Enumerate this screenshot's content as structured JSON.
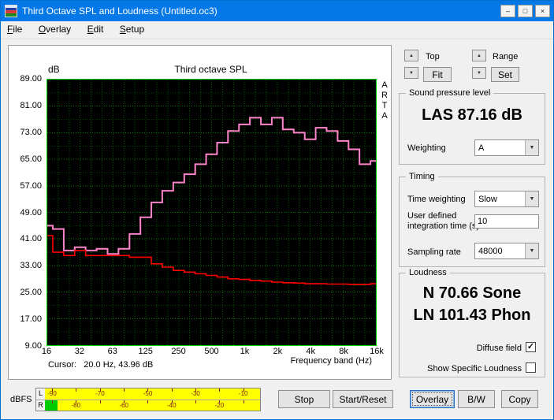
{
  "window": {
    "title": "Third Octave SPL and Loudness (Untitled.oc3)",
    "controls": {
      "minimize": "–",
      "maximize": "□",
      "close": "×"
    }
  },
  "menu": {
    "items": [
      {
        "label": "File"
      },
      {
        "label": "Overlay"
      },
      {
        "label": "Edit"
      },
      {
        "label": "Setup"
      }
    ]
  },
  "chart_data": {
    "type": "line",
    "subtype": "third-octave-staircase",
    "title": "Third octave SPL",
    "ylabel": "dB",
    "xlabel": "Frequency band (Hz)",
    "watermark": "ARTA",
    "ylim": [
      9,
      89
    ],
    "ytick_step": 8,
    "yticks": [
      "89.00",
      "81.00",
      "73.00",
      "65.00",
      "57.00",
      "49.00",
      "41.00",
      "33.00",
      "25.00",
      "17.00",
      "9.00"
    ],
    "xticks": [
      "16",
      "32",
      "63",
      "125",
      "250",
      "500",
      "1k",
      "2k",
      "4k",
      "8k",
      "16k"
    ],
    "xtick_band_index": [
      0,
      3,
      6,
      9,
      12,
      15,
      18,
      21,
      24,
      27,
      30
    ],
    "bands_hz": [
      16,
      20,
      25,
      31.5,
      40,
      50,
      63,
      80,
      100,
      125,
      160,
      200,
      250,
      315,
      400,
      500,
      630,
      800,
      1000,
      1250,
      1600,
      2000,
      2500,
      3150,
      4000,
      5000,
      6300,
      8000,
      10000,
      12500,
      16000
    ],
    "grid": {
      "bg": "#000000",
      "minor_color": "#004a00",
      "major_color": "#008200",
      "vert_color": "#005e00",
      "border_color": "#00d000"
    },
    "series": [
      {
        "name": "spl-bands",
        "color": "#ff85cb",
        "width": 2,
        "values": [
          45,
          44,
          37.5,
          38.5,
          37.5,
          38,
          36.5,
          38,
          42.5,
          47.5,
          52,
          55.5,
          58,
          60.5,
          63.5,
          66.5,
          70,
          73.5,
          75.5,
          77.5,
          75.5,
          77.5,
          74,
          73,
          71,
          74.5,
          73.5,
          70.5,
          68,
          63.5,
          64.5
        ]
      },
      {
        "name": "reference-curve",
        "color": "#ff0000",
        "width": 1.6,
        "values": [
          42,
          37,
          36,
          37.5,
          36,
          36,
          36,
          36,
          35.5,
          35.5,
          33.5,
          32.5,
          31.5,
          31,
          30.5,
          30,
          29.5,
          29,
          28.8,
          28.5,
          28.3,
          28,
          27.8,
          27.7,
          27.5,
          27.5,
          27.4,
          27.4,
          27.3,
          27.3,
          27.5
        ]
      }
    ],
    "cursor_readout": "Cursor:   20.0 Hz, 43.96 dB"
  },
  "scale_controls": {
    "up_icon": "▲",
    "down_icon": "▼",
    "top_label": "Top",
    "fit_button": "Fit",
    "range_label": "Range",
    "set_button": "Set"
  },
  "spl_group": {
    "title": "Sound pressure level",
    "value": "LAS 87.16 dB",
    "weighting_label": "Weighting",
    "weighting_value": "A"
  },
  "timing_group": {
    "title": "Timing",
    "time_weighting_label": "Time weighting",
    "time_weighting_value": "Slow",
    "integration_label_line1": "User defined",
    "integration_label_line2": "integration time (s)",
    "integration_value": "10",
    "sampling_label": "Sampling rate",
    "sampling_value": "48000"
  },
  "loudness_group": {
    "title": "Loudness",
    "n_value": "N 70.66 Sone",
    "ln_value": "LN 101.43 Phon",
    "diffuse_label": "Diffuse field",
    "diffuse_checked": true,
    "specific_label": "Show Specific Loudness",
    "specific_checked": false
  },
  "meter": {
    "unit_label": "dBFS",
    "left_channel": "L",
    "right_channel": "R",
    "top_scale": [
      -90,
      -70,
      -50,
      -30,
      -10
    ],
    "bottom_scale": [
      -80,
      -60,
      -40,
      -20
    ],
    "right_level_fraction": 0.06
  },
  "footer_buttons": {
    "stop": "Stop",
    "start_reset": "Start/Reset",
    "overlay": "Overlay",
    "bw": "B/W",
    "copy": "Copy"
  }
}
